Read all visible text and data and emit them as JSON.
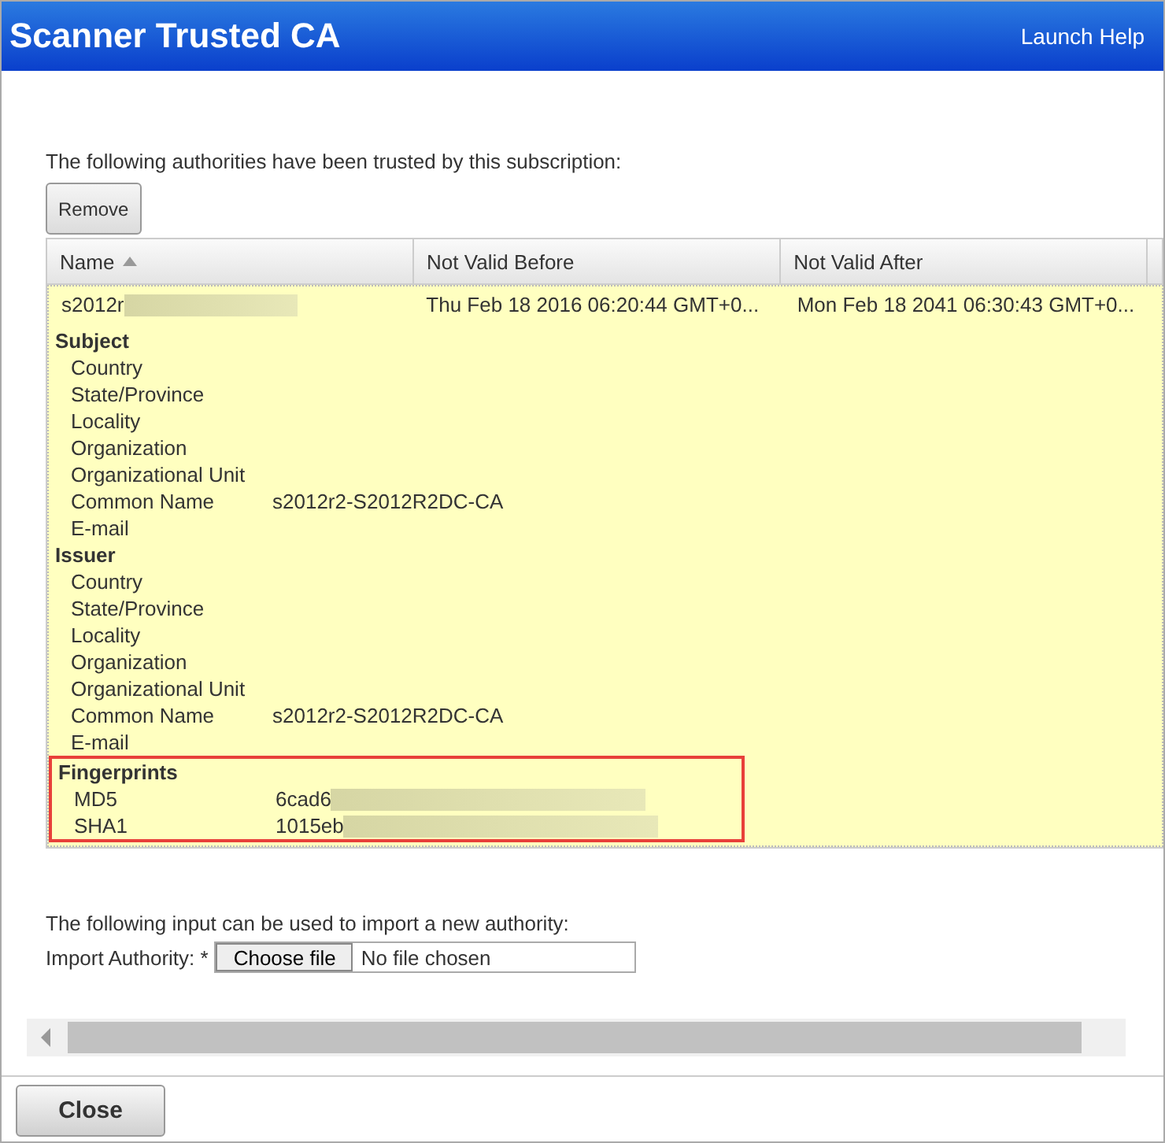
{
  "window": {
    "title": "Scanner Trusted CA",
    "help_link": "Launch Help"
  },
  "intro": "The following authorities have been trusted by this subscription:",
  "remove_button": "Remove",
  "table": {
    "columns": [
      {
        "label": "Name",
        "sorted": true
      },
      {
        "label": "Not Valid Before",
        "sorted": false
      },
      {
        "label": "Not Valid After",
        "sorted": false
      }
    ],
    "rows": [
      {
        "selected": true,
        "cells": [
          "s2012r",
          "Thu Feb 18 2016 06:20:44 GMT+0...",
          "Mon Feb 18 2041 06:30:43 GMT+0..."
        ],
        "details": [
          {
            "heading": "Subject",
            "highlighted": false,
            "fields": [
              {
                "label": "Country"
              },
              {
                "label": "State/Province"
              },
              {
                "label": "Locality"
              },
              {
                "label": "Organization"
              },
              {
                "label": "Organizational Unit"
              },
              {
                "label": "Common Name",
                "value": "s2012r2-S2012R2DC-CA"
              },
              {
                "label": "E-mail"
              }
            ]
          },
          {
            "heading": "Issuer",
            "highlighted": false,
            "fields": [
              {
                "label": "Country"
              },
              {
                "label": "State/Province"
              },
              {
                "label": "Locality"
              },
              {
                "label": "Organization"
              },
              {
                "label": "Organizational Unit"
              },
              {
                "label": "Common Name",
                "value": "s2012r2-S2012R2DC-CA"
              },
              {
                "label": "E-mail"
              }
            ]
          },
          {
            "heading": "Fingerprints",
            "highlighted": true,
            "fields": [
              {
                "label": "MD5",
                "value": "6cad6"
              },
              {
                "label": "SHA1",
                "value": "1015eb"
              }
            ]
          }
        ]
      }
    ]
  },
  "import": {
    "intro": "The following input can be used to import a new authority:",
    "label": "Import Authority: *",
    "button": "Choose file",
    "status": "No file chosen"
  },
  "close_button": "Close"
}
